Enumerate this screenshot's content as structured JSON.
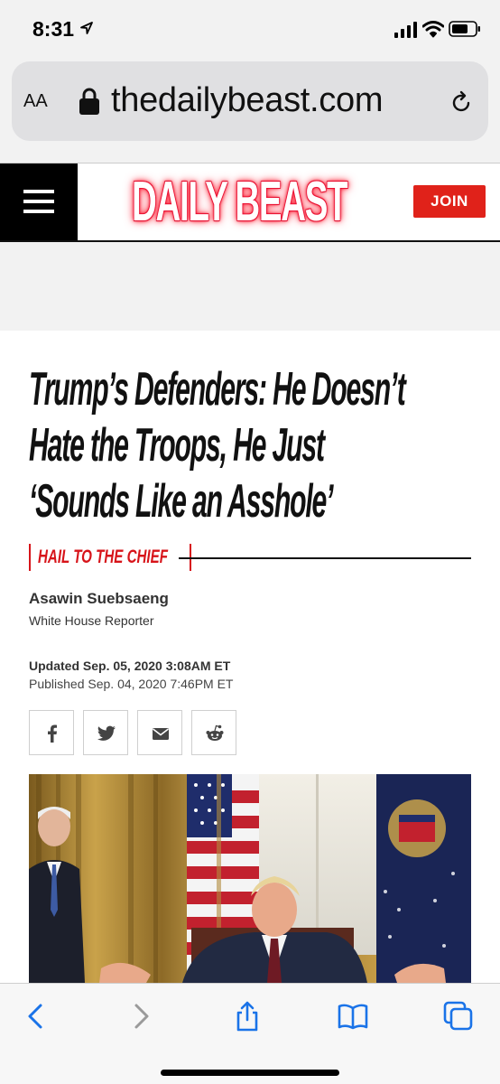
{
  "status_bar": {
    "time": "8:31"
  },
  "browser": {
    "font_size_label": "AA",
    "url": "thedailybeast.com"
  },
  "site": {
    "logo": "DAILY BEAST",
    "join_label": "JOIN",
    "brand_color": "#e0221a"
  },
  "article": {
    "headline_lines": [
      "Trump’s Defenders: He Doesn’t",
      "Hate the Troops, He Just",
      "‘Sounds Like an Asshole’"
    ],
    "section": "HAIL TO THE CHIEF",
    "author": "Asawin Suebsaeng",
    "author_title": "White House Reporter",
    "updated": "Updated Sep. 05, 2020 3:08AM ET",
    "published": "Published Sep. 04, 2020 7:46PM ET"
  },
  "share_buttons": [
    {
      "icon": "facebook-icon"
    },
    {
      "icon": "twitter-icon"
    },
    {
      "icon": "email-icon"
    },
    {
      "icon": "reddit-icon"
    }
  ],
  "toolbar": {
    "buttons": [
      "back-icon",
      "forward-icon",
      "share-icon",
      "bookmarks-icon",
      "tabs-icon"
    ],
    "accent_color": "#1a73e8"
  }
}
